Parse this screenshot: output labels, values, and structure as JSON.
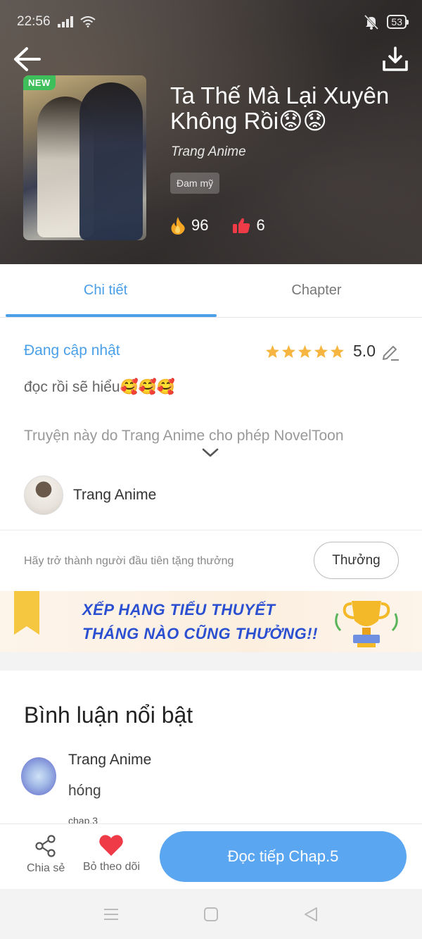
{
  "status_bar": {
    "time": "22:56",
    "battery": "53"
  },
  "header": {
    "title": "Ta Thế Mà Lại Xuyên Không Rồi😟😟",
    "author": "Trang Anime",
    "genre": "Đam mỹ",
    "badge": "NEW",
    "fire_count": "96",
    "like_count": "6"
  },
  "tabs": [
    {
      "label": "Chi tiết",
      "active": true
    },
    {
      "label": "Chapter",
      "active": false
    }
  ],
  "detail": {
    "status": "Đang cập nhật",
    "rating": "5.0",
    "description": "đọc rồi sẽ hiểu🥰🥰🥰",
    "permission_text": "Truyện này do Trang Anime cho phép NovelToon",
    "author_name": "Trang Anime"
  },
  "reward": {
    "prompt": "Hãy trở thành người đầu tiên tặng thưởng",
    "button": "Thưởng"
  },
  "banner": {
    "line1": "XẾP HẠNG TIỂU THUYẾT",
    "line2": "THÁNG NÀO CŨNG THƯỞNG!!"
  },
  "comments": {
    "title": "Bình luận nổi bật",
    "items": [
      {
        "user": "Trang Anime",
        "text": "hóng",
        "chapter": "chap.3"
      }
    ]
  },
  "bottom_bar": {
    "share_label": "Chia sẻ",
    "follow_label": "Bỏ theo dõi",
    "read_button": "Đọc tiếp Chap.5"
  },
  "colors": {
    "accent": "#4a9fe8",
    "read_button": "#5aa6f1",
    "heart": "#ee3b47",
    "star": "#f5b540",
    "new_badge": "#3fbf5b"
  }
}
